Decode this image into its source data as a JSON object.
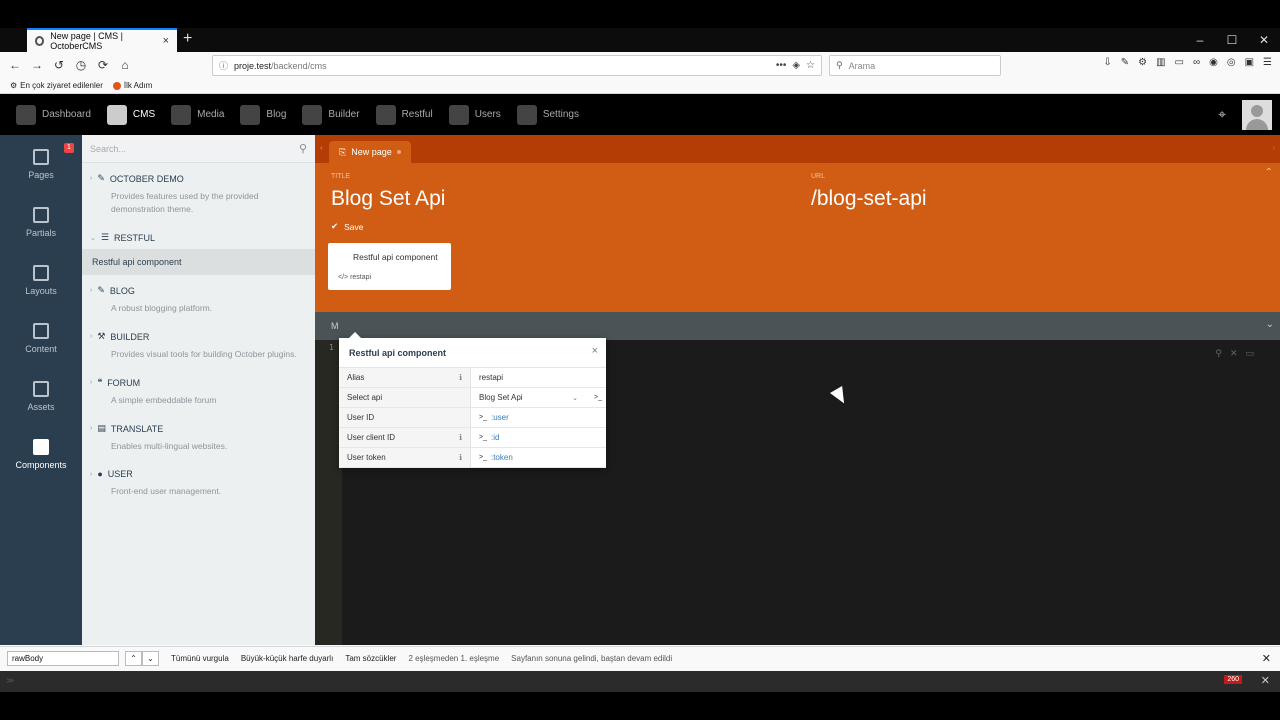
{
  "browser": {
    "tab_title": "New page | CMS | OctoberCMS",
    "tab_close": "×",
    "new_tab": "+",
    "win_minimize": "–",
    "win_maximize": "☐",
    "win_close": "✕",
    "url_host": "proje.test",
    "url_path": "/backend/cms",
    "search_placeholder": "Arama",
    "bookmarks": [
      {
        "label": "En çok ziyaret edilenler",
        "icon": "gear-icon"
      },
      {
        "label": "İlk Adım",
        "icon": "firefox-icon"
      }
    ]
  },
  "topnav": {
    "items": [
      {
        "label": "Dashboard",
        "icon": "dashboard-icon"
      },
      {
        "label": "CMS",
        "icon": "cms-icon",
        "active": true
      },
      {
        "label": "Media",
        "icon": "media-icon"
      },
      {
        "label": "Blog",
        "icon": "blog-icon"
      },
      {
        "label": "Builder",
        "icon": "builder-icon"
      },
      {
        "label": "Restful",
        "icon": "database-icon"
      },
      {
        "label": "Users",
        "icon": "user-icon"
      },
      {
        "label": "Settings",
        "icon": "gear-icon"
      }
    ]
  },
  "sidebar": {
    "items": [
      {
        "label": "Pages",
        "icon": "pages-icon",
        "badge": "1"
      },
      {
        "label": "Partials",
        "icon": "tag-icon"
      },
      {
        "label": "Layouts",
        "icon": "layouts-icon"
      },
      {
        "label": "Content",
        "icon": "file-icon"
      },
      {
        "label": "Assets",
        "icon": "image-icon"
      },
      {
        "label": "Components",
        "icon": "puzzle-icon",
        "active": true
      }
    ]
  },
  "components_panel": {
    "search_placeholder": "Search...",
    "plugins": [
      {
        "title": "OCTOBER DEMO",
        "desc": "Provides features used by the provided demonstration theme."
      },
      {
        "title": "RESTFUL",
        "desc": "",
        "component": "Restful api component"
      },
      {
        "title": "BLOG",
        "desc": "A robust blogging platform."
      },
      {
        "title": "BUILDER",
        "desc": "Provides visual tools for building October plugins."
      },
      {
        "title": "FORUM",
        "desc": "A simple embeddable forum"
      },
      {
        "title": "TRANSLATE",
        "desc": "Enables multi-lingual websites."
      },
      {
        "title": "USER",
        "desc": "Front-end user management."
      }
    ]
  },
  "editor": {
    "tab_label": "New page",
    "title_label": "TITLE",
    "title_value": "Blog Set Api",
    "url_label": "URL",
    "url_value": "/blog-set-api",
    "save_label": "Save",
    "component_card": {
      "name": "Restful api component",
      "alias": "restapi"
    },
    "codebar_label": "M",
    "line_number": "1"
  },
  "inspector": {
    "title": "Restful api component",
    "close": "×",
    "rows": [
      {
        "label": "Alias",
        "info": true,
        "value": "restapi"
      },
      {
        "label": "Select api",
        "info": false,
        "value": "Blog Set Api",
        "dropdown": true
      },
      {
        "label": "User ID",
        "info": false,
        "value": ":user",
        "terminal": true
      },
      {
        "label": "User client ID",
        "info": true,
        "value": ":id",
        "terminal": true
      },
      {
        "label": "User token",
        "info": true,
        "value": ":token",
        "terminal": true
      }
    ]
  },
  "findbar": {
    "value": "rawBody",
    "highlight_all": "Tümünü vurgula",
    "match_case": "Büyük-küçük harfe duyarlı",
    "whole_words": "Tam sözcükler",
    "match_status": "2 eşleşmeden 1. eşleşme",
    "wrap_status": "Sayfanın sonuna gelindi, baştan devam edildi"
  },
  "console": {
    "badge": "260"
  }
}
